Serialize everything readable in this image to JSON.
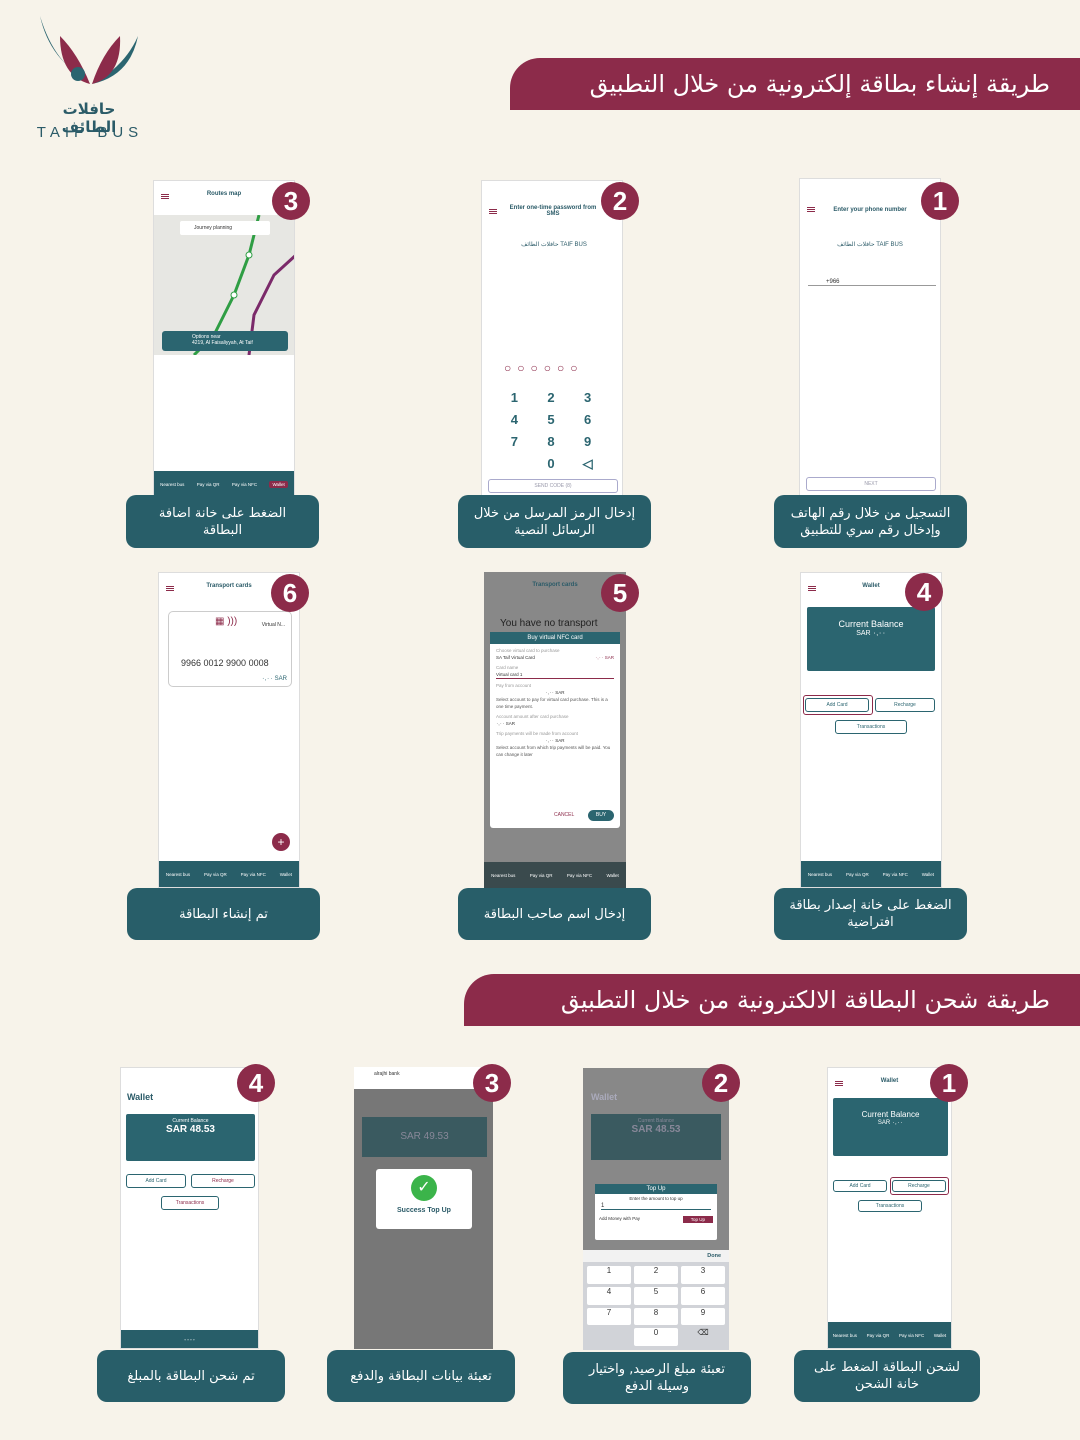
{
  "logo": {
    "arabic": "حافلات الطائف",
    "english": "TAIF BUS"
  },
  "section1": {
    "title": "طريقة إنشاء بطاقة إلكترونية  من خلال التطبيق",
    "captions": [
      "التسجيل من خلال رقم الهاتف وإدخال رقم سري للتطبيق",
      "إدخال الرمز المرسل من خلال الرسائل النصية",
      "الضغط على خانة اضافة البطاقة",
      "الضغط على خانة إصدار بطاقة افتراضية",
      "إدخال اسم صاحب البطاقة",
      "تم إنشاء البطاقة"
    ]
  },
  "section2": {
    "title": "طريقة شحن البطاقة الالكترونية من خلال التطبيق",
    "captions": [
      "لشحن البطاقة الضغط على خانة الشحن",
      "تعبئة مبلغ الرصيد, واختيار وسيلة الدفع",
      "تعبئة بيانات البطاقة والدفع",
      "تم شحن البطاقة بالمبلغ"
    ]
  },
  "steps": [
    "1",
    "2",
    "3",
    "4",
    "5",
    "6"
  ],
  "screens": {
    "phone": {
      "header": "Enter your phone number",
      "code": "+966",
      "next": "NEXT"
    },
    "otp": {
      "header": "Enter one-time password from SMS",
      "keys": [
        "1",
        "2",
        "3",
        "4",
        "5",
        "6",
        "7",
        "8",
        "9",
        "0"
      ],
      "send": "SEND CODE (8)"
    },
    "map": {
      "header": "Routes map",
      "search": "Journey planning",
      "options": "Options near",
      "address": "4219, Al Faisaliyyah, At Taif"
    },
    "nav": {
      "nearest": "Nearest bus",
      "qr": "Pay via QR",
      "nfc": "Pay via NFC",
      "wallet": "Wallet"
    },
    "wallet": {
      "header": "Wallet",
      "balance_label": "Current Balance",
      "balance": "SAR ٠,٠٠",
      "add": "Add Card",
      "recharge": "Recharge",
      "transactions": "Transactions"
    },
    "buy": {
      "header": "Transport cards",
      "bg_text": "You have no transport",
      "title": "Buy virtual NFC card",
      "choose": "Choose virtual card to purchase",
      "card_type": "SA Taif  Virtual Card",
      "price": "٠,٠٠ SAR",
      "name_label": "Card name",
      "name_value": "Virtual card 1",
      "pay_label": "Pay from account",
      "pay_value": "٠,٠٠ SAR",
      "hint1": "Select account to pay for virtual card purchase. This is a one time payment.",
      "after_label": "Account amount after card purchase",
      "after_value": "٠,٠٠ SAR",
      "trip_label": "Trip payments will be made from account",
      "trip_value": "٠,٠٠ SAR",
      "hint2": "Select account from which trip payments will be paid. You can change it later",
      "cancel": "CANCEL",
      "buy": "BUY"
    },
    "cards": {
      "header": "Transport cards",
      "number": "9966  0012  9900  0008",
      "amount": "٠,٠٠ SAR",
      "name": "Virtual N..."
    },
    "topup": {
      "wallet": "Wallet",
      "balance_label": "Current Balance",
      "balance": "SAR 48.53",
      "title": "Top Up",
      "prompt": "Enter the amount to top up",
      "amount": "1",
      "money_with": "Add Money with",
      "apple": "Pay",
      "button": "Top Up",
      "done": "Done",
      "keys": [
        "1",
        "2",
        "3",
        "4",
        "5",
        "6",
        "7",
        "8",
        "9",
        "0"
      ]
    },
    "success": {
      "bank": "alrajhi bank",
      "balance": "SAR 49.53",
      "message": "Success Top Up"
    },
    "final": {
      "wallet": "Wallet",
      "balance_label": "Current Balance",
      "balance": "SAR 48.53"
    }
  }
}
